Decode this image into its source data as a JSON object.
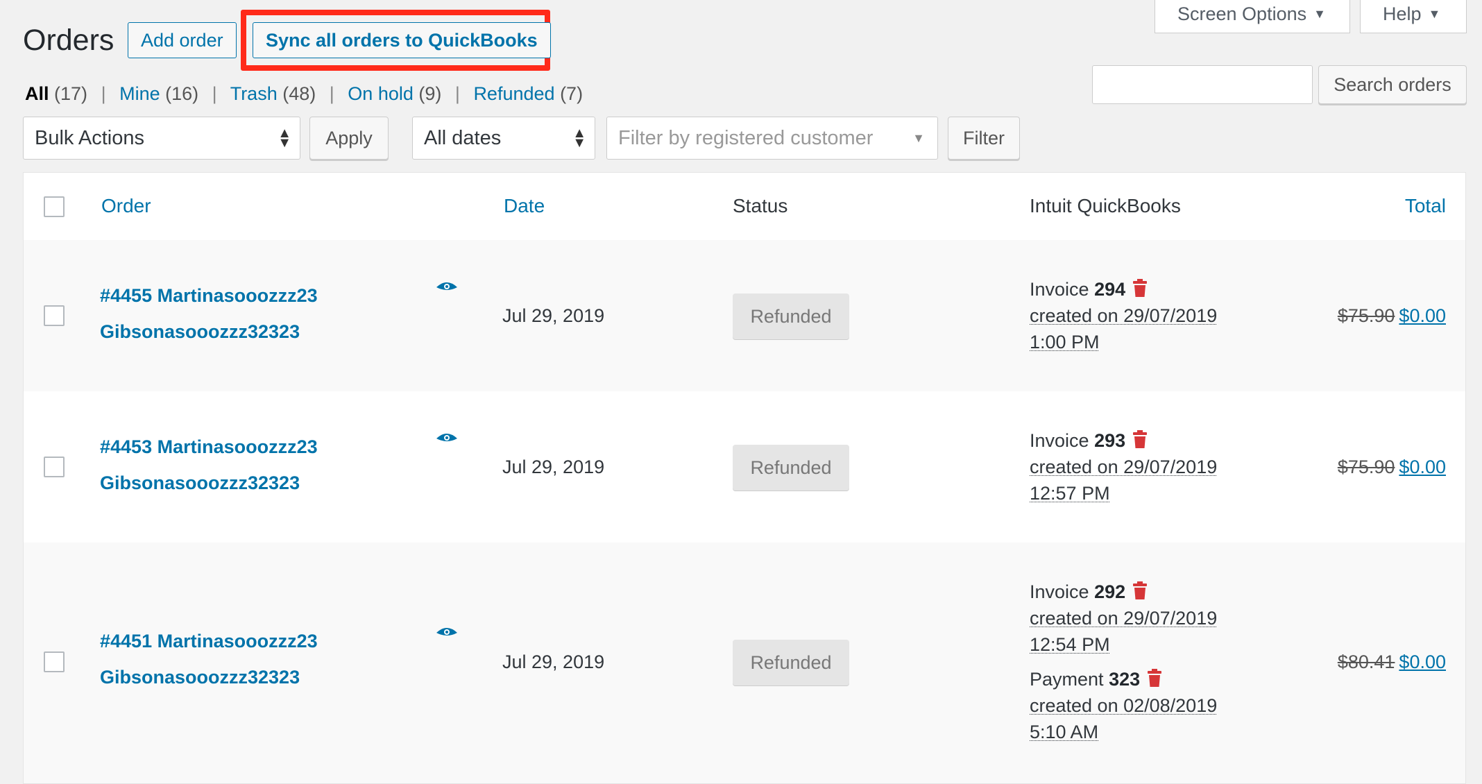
{
  "header": {
    "title": "Orders",
    "add_order": "Add order",
    "sync_button": "Sync all orders to QuickBooks",
    "screen_options": "Screen Options",
    "help": "Help"
  },
  "search": {
    "placeholder": "",
    "button": "Search orders"
  },
  "views": [
    {
      "label": "All",
      "count": "(17)"
    },
    {
      "label": "Mine",
      "count": "(16)"
    },
    {
      "label": "Trash",
      "count": "(48)"
    },
    {
      "label": "On hold",
      "count": "(9)"
    },
    {
      "label": "Refunded",
      "count": "(7)"
    }
  ],
  "filters": {
    "bulk_actions": "Bulk Actions",
    "apply": "Apply",
    "dates": "All dates",
    "customer_placeholder": "Filter by registered customer",
    "filter": "Filter"
  },
  "table": {
    "columns": {
      "order": "Order",
      "date": "Date",
      "status": "Status",
      "qb": "Intuit QuickBooks",
      "total": "Total"
    },
    "rows": [
      {
        "order_line1": "#4455 Martinasooozzz23",
        "order_line2": "Gibsonasooozzz32323",
        "date": "Jul 29, 2019",
        "status": "Refunded",
        "qb": [
          {
            "type": "Invoice",
            "number": "294",
            "created": "created on 29/07/2019",
            "time": "1:00 PM"
          }
        ],
        "total_old": "$75.90",
        "total_new": "$0.00"
      },
      {
        "order_line1": "#4453 Martinasooozzz23",
        "order_line2": "Gibsonasooozzz32323",
        "date": "Jul 29, 2019",
        "status": "Refunded",
        "qb": [
          {
            "type": "Invoice",
            "number": "293",
            "created": "created on 29/07/2019",
            "time": "12:57 PM"
          }
        ],
        "total_old": "$75.90",
        "total_new": "$0.00"
      },
      {
        "order_line1": "#4451 Martinasooozzz23",
        "order_line2": "Gibsonasooozzz32323",
        "date": "Jul 29, 2019",
        "status": "Refunded",
        "qb": [
          {
            "type": "Invoice",
            "number": "292",
            "created": "created on 29/07/2019",
            "time": "12:54 PM"
          },
          {
            "type": "Payment",
            "number": "323",
            "created": "created on 02/08/2019",
            "time": "5:10 AM"
          }
        ],
        "total_old": "$80.41",
        "total_new": "$0.00"
      }
    ]
  },
  "colors": {
    "link": "#0073aa",
    "highlight": "#ff2a1a",
    "trash": "#d63638"
  }
}
